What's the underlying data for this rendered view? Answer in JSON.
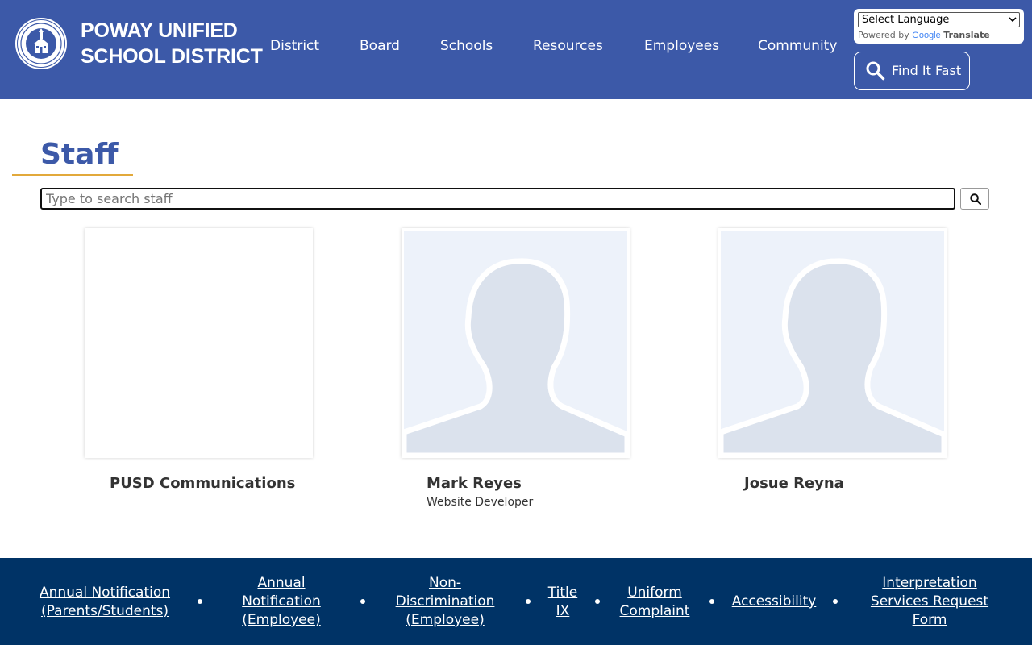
{
  "header": {
    "brand_line1": "POWAY UNIFIED",
    "brand_line2": "SCHOOL DISTRICT",
    "nav": [
      "District",
      "Board",
      "Schools",
      "Resources",
      "Employees",
      "Community"
    ],
    "translate": {
      "select_value": "Select Language",
      "powered_by": "Powered by",
      "google": "Google",
      "translate": "Translate"
    },
    "find_it_fast": "Find It Fast"
  },
  "main": {
    "title": "Staff",
    "search": {
      "placeholder": "Type to search staff"
    },
    "staff": [
      {
        "name": "PUSD Communications",
        "role": ""
      },
      {
        "name": "Mark Reyes",
        "role": "Website Developer"
      },
      {
        "name": "Josue Reyna",
        "role": ""
      }
    ]
  },
  "footer": {
    "links": [
      "Annual Notification (Parents/Students)",
      "Annual Notification (Employee)",
      "Non-Discrimination (Employee)",
      "Title IX",
      "Uniform Complaint",
      "Accessibility",
      "Interpretation Services Request Form"
    ]
  },
  "colors": {
    "header_bg": "#3c59a8",
    "footer_bg": "#003366",
    "title_color": "#3c59a8",
    "underline_accent": "#e2a93b",
    "placeholder_bg": "#edf2fa",
    "silhouette": "#dbe2ed"
  }
}
